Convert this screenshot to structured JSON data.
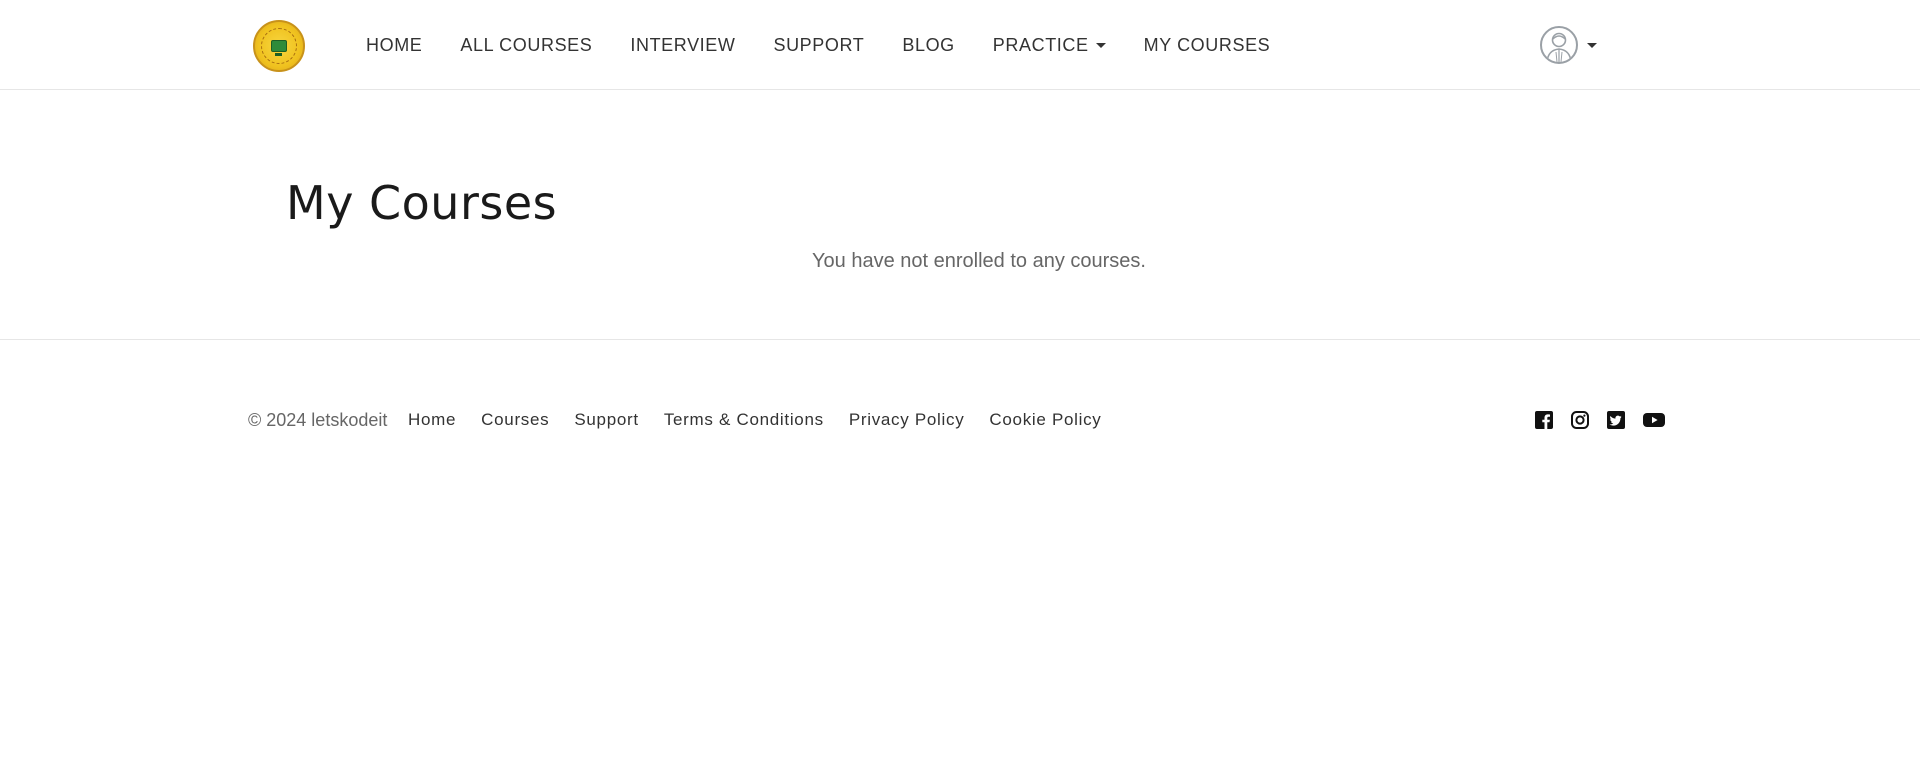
{
  "header": {
    "nav": [
      {
        "label": "HOME"
      },
      {
        "label": "ALL COURSES"
      },
      {
        "label": "INTERVIEW"
      },
      {
        "label": "SUPPORT"
      },
      {
        "label": "BLOG"
      },
      {
        "label": "PRACTICE"
      },
      {
        "label": "MY COURSES"
      }
    ],
    "logo_icon": "letskodeit-logo-icon",
    "user_icon": "user-avatar-icon"
  },
  "main": {
    "title": "My Courses",
    "empty_message": "You have not enrolled to any courses."
  },
  "footer": {
    "copyright": "© 2024 letskodeit",
    "links": [
      {
        "label": "Home"
      },
      {
        "label": "Courses"
      },
      {
        "label": "Support"
      },
      {
        "label": "Terms & Conditions"
      },
      {
        "label": "Privacy Policy"
      },
      {
        "label": "Cookie Policy"
      }
    ],
    "social_icons": [
      "facebook-icon",
      "instagram-icon",
      "twitter-icon",
      "youtube-icon"
    ]
  },
  "colors": {
    "text": "#333333",
    "muted": "#666666",
    "divider": "#e6e6e6",
    "logo_gold": "#f0c21f"
  }
}
